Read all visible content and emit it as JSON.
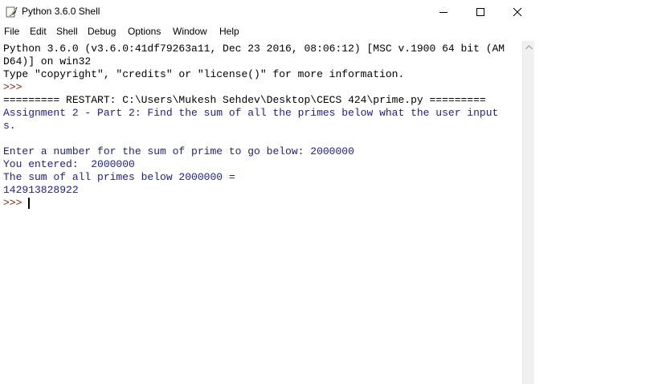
{
  "window": {
    "title": "Python 3.6.0 Shell"
  },
  "menu": [
    "File",
    "Edit",
    "Shell",
    "Debug",
    "Options",
    "Window",
    "Help"
  ],
  "shell": {
    "lines": [
      {
        "text": "Python 3.6.0 (v3.6.0:41df79263a11, Dec 23 2016, 08:06:12) [MSC v.1900 64 bit (AM",
        "color": "black"
      },
      {
        "text": "D64)] on win32",
        "color": "black"
      },
      {
        "text": "Type \"copyright\", \"credits\" or \"license()\" for more information.",
        "color": "black"
      },
      {
        "text": ">>> ",
        "color": "brown"
      },
      {
        "text": "========= RESTART: C:\\Users\\Mukesh Sehdev\\Desktop\\CECS 424\\prime.py =========",
        "color": "black"
      },
      {
        "text": "Assignment 2 - Part 2: Find the sum of all the primes below what the user input",
        "color": "blue"
      },
      {
        "text": "s.",
        "color": "blue"
      },
      {
        "text": "",
        "color": "blue"
      },
      {
        "text": "Enter a number for the sum of prime to go below: 2000000",
        "color": "blue"
      },
      {
        "text": "You entered:  2000000",
        "color": "blue"
      },
      {
        "text": "The sum of all primes below 2000000 =",
        "color": "blue"
      },
      {
        "text": "142913828922",
        "color": "blue"
      },
      {
        "text": ">>> ",
        "color": "brown"
      }
    ]
  },
  "colors": {
    "output": "#1a1ab0",
    "prompt": "#8b2500",
    "text": "#000000"
  }
}
